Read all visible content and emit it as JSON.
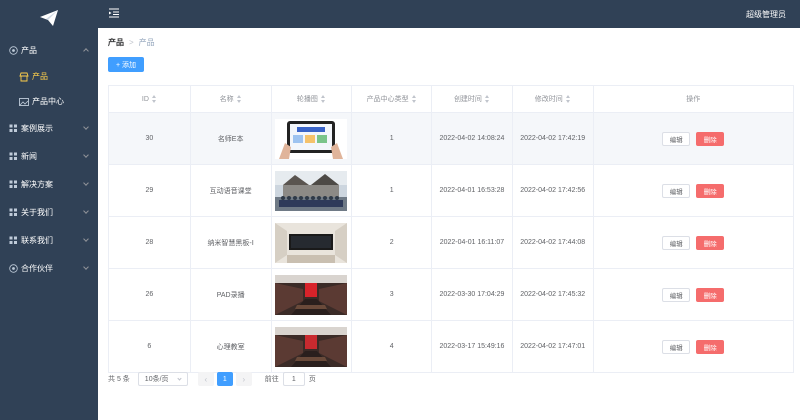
{
  "sidebar": {
    "logo_icon": "paper-plane-icon",
    "menus": [
      {
        "label": "产品",
        "icon": "target-icon",
        "expanded": true
      },
      {
        "label": "案例展示",
        "icon": "grid-icon",
        "expanded": false
      },
      {
        "label": "新闻",
        "icon": "grid-icon",
        "expanded": false
      },
      {
        "label": "解决方案",
        "icon": "grid-icon",
        "expanded": false
      },
      {
        "label": "关于我们",
        "icon": "grid-icon",
        "expanded": false
      },
      {
        "label": "联系我们",
        "icon": "grid-icon",
        "expanded": false
      },
      {
        "label": "合作伙伴",
        "icon": "target-icon",
        "expanded": false
      }
    ],
    "submenu": [
      {
        "label": "产品",
        "icon": "shop-icon",
        "active": true
      },
      {
        "label": "产品中心",
        "icon": "picture-icon",
        "active": false
      }
    ],
    "active_color": "#ffd04b",
    "bg_color": "#304156"
  },
  "header": {
    "username": "超级管理员",
    "toggle_icon": "fold-menu-icon"
  },
  "breadcrumb": {
    "level1": "产品",
    "level2": "产品"
  },
  "toolbar": {
    "add_label": "+ 添加"
  },
  "table": {
    "headers": [
      "ID",
      "名称",
      "轮播图",
      "产品中心类型",
      "创建时间",
      "修改时间",
      "操作"
    ],
    "rows": [
      {
        "id": "30",
        "name": "名师E本",
        "image": "tablet-photo",
        "type": "1",
        "created": "2022-04-02 14:08:24",
        "modified": "2022-04-02 17:42:19"
      },
      {
        "id": "29",
        "name": "互动语音课堂",
        "image": "group-photo",
        "type": "1",
        "created": "2022-04-01 16:53:28",
        "modified": "2022-04-02 17:42:56"
      },
      {
        "id": "28",
        "name": "纳米智慧黑板-Ⅰ",
        "image": "classroom-board-photo",
        "type": "2",
        "created": "2022-04-01 16:11:07",
        "modified": "2022-04-02 17:44:08"
      },
      {
        "id": "26",
        "name": "PAD录播",
        "image": "meeting-room-photo",
        "type": "3",
        "created": "2022-03-30 17:04:29",
        "modified": "2022-04-02 17:45:32"
      },
      {
        "id": "6",
        "name": "心理教室",
        "image": "meeting-room-photo",
        "type": "4",
        "created": "2022-03-17 15:49:16",
        "modified": "2022-04-02 17:47:01"
      }
    ],
    "edit_label": "编辑",
    "delete_label": "删除"
  },
  "pagination": {
    "total": "共 5 条",
    "page_size": "10条/页",
    "prev": "‹",
    "next": "›",
    "current": "1",
    "goto_label": "前往",
    "goto_value": "1",
    "page_suffix": "页"
  }
}
